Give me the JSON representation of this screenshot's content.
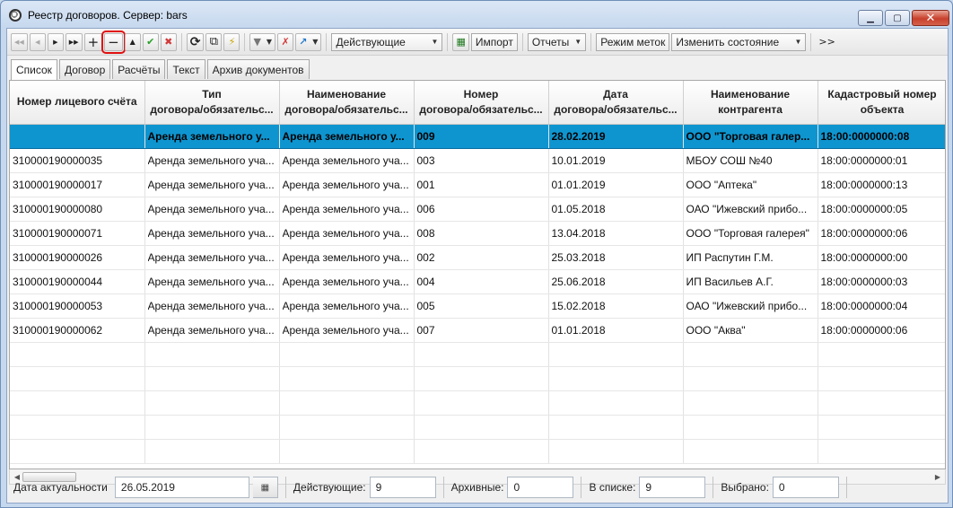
{
  "window": {
    "title": "Реестр договоров. Сервер: bars"
  },
  "toolbar": {
    "first": "◀◀",
    "prev": "◀",
    "next": "▶",
    "last": "▶▶",
    "add": "+",
    "remove": "−",
    "up": "▲",
    "apply": "✔",
    "cancel": "✖",
    "refresh": "⟳",
    "copy": "⧉",
    "export": "⚡",
    "filter": "▼",
    "clear_filter": "✗",
    "goto": "↗",
    "status_combo": "Действующие",
    "import": "Импорт",
    "reports": "Отчеты",
    "tag_mode": "Режим меток",
    "change_state": "Изменить состояние",
    "more": ">>"
  },
  "tabs": [
    "Список",
    "Договор",
    "Расчёты",
    "Текст",
    "Архив документов"
  ],
  "grid": {
    "columns": [
      {
        "line1": "Номер лицевого счёта",
        "line2": ""
      },
      {
        "line1": "Тип",
        "line2": "договора/обязательс..."
      },
      {
        "line1": "Наименование",
        "line2": "договора/обязательс..."
      },
      {
        "line1": "Номер",
        "line2": "договора/обязательс..."
      },
      {
        "line1": "Дата",
        "line2": "договора/обязательс..."
      },
      {
        "line1": "Наименование",
        "line2": "контрагента"
      },
      {
        "line1": "Кадастровый номер",
        "line2": "объекта"
      }
    ],
    "rows": [
      [
        "",
        "Аренда земельного у...",
        "Аренда земельного у...",
        "009",
        "28.02.2019",
        "ООО \"Торговая галер...",
        "18:00:0000000:08"
      ],
      [
        "310000190000035",
        "Аренда земельного уча...",
        "Аренда земельного уча...",
        "003",
        "10.01.2019",
        "МБОУ СОШ №40",
        "18:00:0000000:01"
      ],
      [
        "310000190000017",
        "Аренда земельного уча...",
        "Аренда земельного уча...",
        "001",
        "01.01.2019",
        "ООО \"Аптека\"",
        "18:00:0000000:13"
      ],
      [
        "310000190000080",
        "Аренда земельного уча...",
        "Аренда земельного уча...",
        "006",
        "01.05.2018",
        "ОАО \"Ижевский прибо...",
        "18:00:0000000:05"
      ],
      [
        "310000190000071",
        "Аренда земельного уча...",
        "Аренда земельного уча...",
        "008",
        "13.04.2018",
        "ООО \"Торговая галерея\"",
        "18:00:0000000:06"
      ],
      [
        "310000190000026",
        "Аренда земельного уча...",
        "Аренда земельного уча...",
        "002",
        "25.03.2018",
        "ИП Распутин Г.М.",
        "18:00:0000000:00"
      ],
      [
        "310000190000044",
        "Аренда земельного уча...",
        "Аренда земельного уча...",
        "004",
        "25.06.2018",
        "ИП Васильев А.Г.",
        "18:00:0000000:03"
      ],
      [
        "310000190000053",
        "Аренда земельного уча...",
        "Аренда земельного уча...",
        "005",
        "15.02.2018",
        "ОАО \"Ижевский прибо...",
        "18:00:0000000:04"
      ],
      [
        "310000190000062",
        "Аренда земельного уча...",
        "Аренда земельного уча...",
        "007",
        "01.01.2018",
        "ООО \"Аква\"",
        "18:00:0000000:06"
      ]
    ],
    "selected_row": 0
  },
  "status": {
    "date_label": "Дата актуальности",
    "date_value": "26.05.2019",
    "active_label": "Действующие:",
    "active_value": "9",
    "archive_label": "Архивные:",
    "archive_value": "0",
    "inlist_label": "В списке:",
    "inlist_value": "9",
    "selected_label": "Выбрано:",
    "selected_value": "0"
  },
  "colors": {
    "selection": "#0e95d0",
    "highlight_box": "#e01010"
  }
}
